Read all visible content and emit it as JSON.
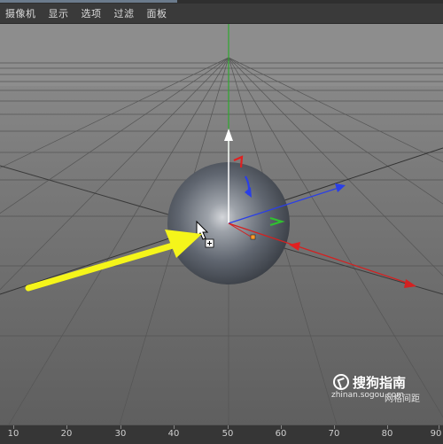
{
  "menu": {
    "items": [
      "摄像机",
      "显示",
      "选项",
      "过滤",
      "面板"
    ]
  },
  "viewport": {
    "background_color": "#7b7b7b",
    "object": "sphere",
    "icons": [
      "move-gizmo-icon",
      "rotate-gizmo-icon",
      "cursor-arrow-icon",
      "yellow-pointer-arrow"
    ]
  },
  "watermark": {
    "logo_text": "搜狗指南",
    "url": "zhinan.sogou.com",
    "overlay_text": "网格间距"
  },
  "timeline": {
    "ticks": [
      "10",
      "20",
      "30",
      "40",
      "50",
      "60",
      "70",
      "80",
      "90"
    ]
  },
  "colors": {
    "x_axis": "#e02020",
    "y_axis": "#30c030",
    "z_axis": "#2040e0",
    "annotation_arrow": "#f5f51a"
  }
}
